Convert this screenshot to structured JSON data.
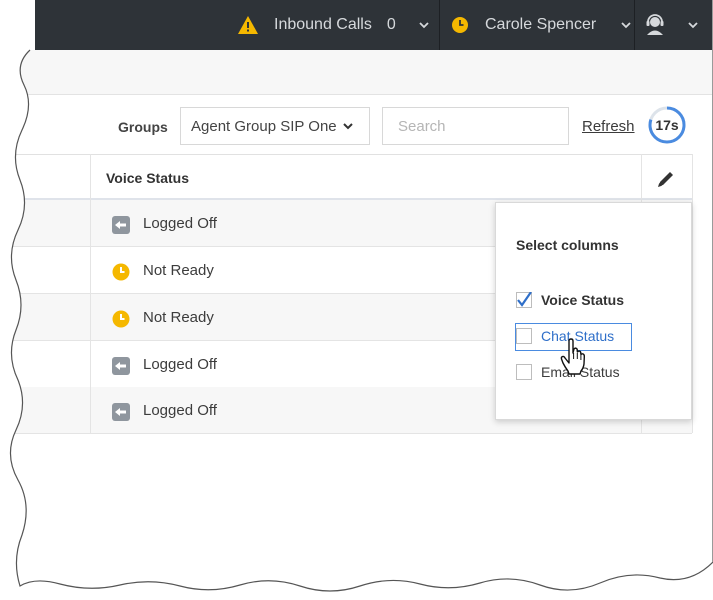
{
  "topbar": {
    "inbound_label": "Inbound Calls",
    "inbound_count": "0",
    "agent_name": "Carole Spencer",
    "warning_icon": "warning-icon",
    "status_icon": "clock-icon",
    "agent_icon": "agent-headset-icon"
  },
  "toolbar": {
    "groups_label": "Groups",
    "groups_value": "Agent Group SIP One",
    "search_placeholder": "Search",
    "refresh_label": "Refresh",
    "timer": "17s",
    "timer_progress": 0.8
  },
  "table": {
    "header_voice": "Voice Status",
    "rows": [
      {
        "status": "Logged Off",
        "icon": "logged-off-icon"
      },
      {
        "status": "Not Ready",
        "icon": "not-ready-clock-icon"
      },
      {
        "status": "Not Ready",
        "icon": "not-ready-clock-icon"
      },
      {
        "status": "Logged Off",
        "icon": "logged-off-icon"
      },
      {
        "status": "Logged Off",
        "icon": "logged-off-icon"
      }
    ]
  },
  "popup": {
    "title": "Select columns",
    "options": [
      {
        "label": "Voice Status",
        "checked": true
      },
      {
        "label": "Chat Status",
        "checked": false
      },
      {
        "label": "Email Status",
        "checked": false
      }
    ]
  },
  "colors": {
    "topbar_bg": "#2e3338",
    "accent_yellow": "#f5b800",
    "link_blue": "#2f6fc9",
    "timer_ring": "#4a8be0"
  }
}
